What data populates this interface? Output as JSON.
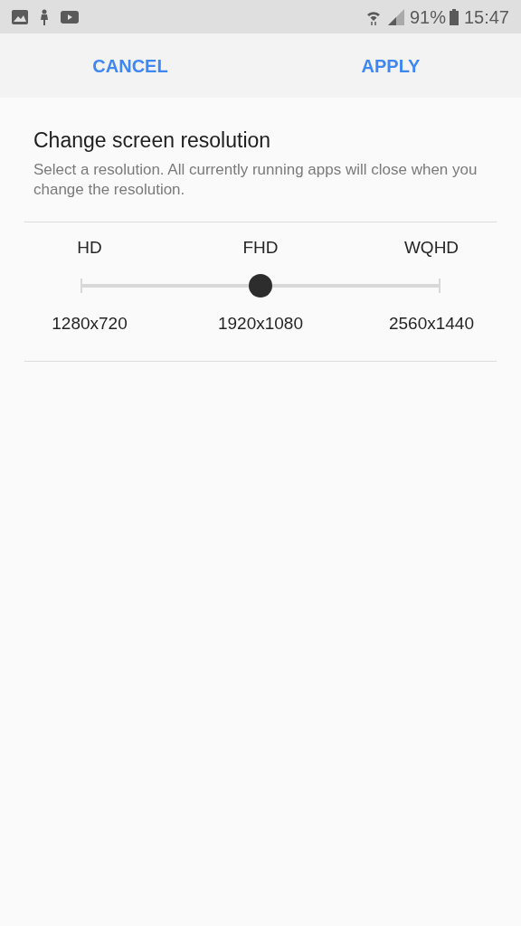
{
  "status_bar": {
    "battery": "91%",
    "time": "15:47"
  },
  "actions": [
    "CANCEL",
    "APPLY"
  ],
  "title": "Change screen resolution",
  "description": "Select a resolution. All currently running apps will close when you change the resolution.",
  "resolution_slider": {
    "level": 0.5,
    "options": [
      {
        "name": "HD",
        "size": "1280x720"
      },
      {
        "name": "FHD",
        "size": "1920x1080"
      },
      {
        "name": "WQHD",
        "size": "2560x1440"
      }
    ]
  }
}
